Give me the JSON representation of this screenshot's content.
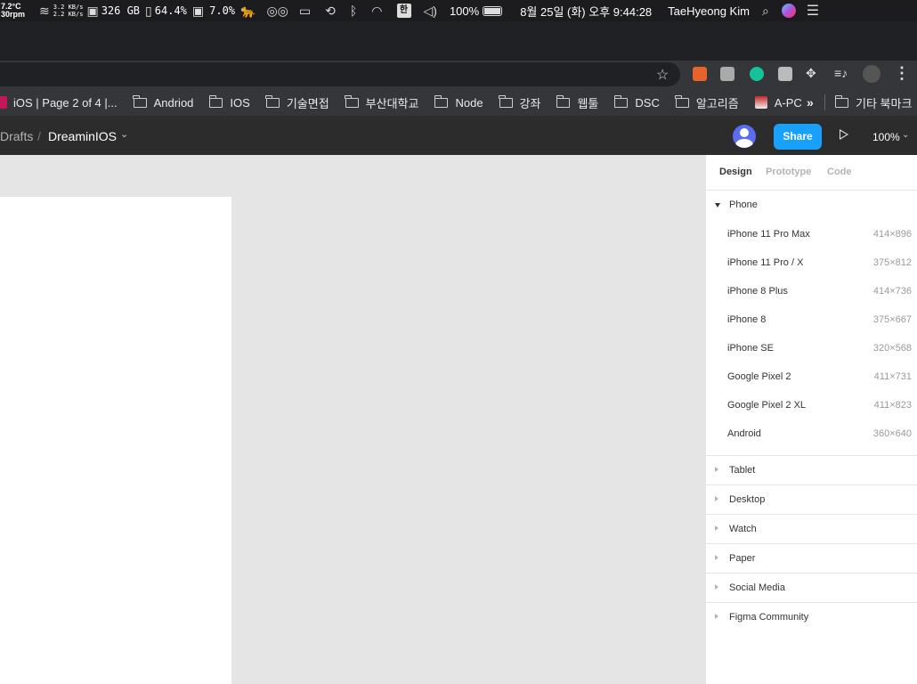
{
  "menubar": {
    "temp_line1": "7.2°C",
    "temp_line2": "30rpm",
    "net_up": "3.2 KB/s",
    "net_down": "2.2 KB/s",
    "disk": "326 GB",
    "memory": "64.4%",
    "cpu": "7.0%",
    "battery_pct": "100%",
    "datetime": "8월 25일 (화) 오후 9:44:28",
    "user": "TaeHyeong Kim",
    "input_lang": "한"
  },
  "bookmarks": [
    {
      "label": "iOS | Page 2 of 4 |...",
      "kind": "site"
    },
    {
      "label": "Andriod",
      "kind": "folder"
    },
    {
      "label": "IOS",
      "kind": "folder"
    },
    {
      "label": "기술면접",
      "kind": "folder"
    },
    {
      "label": "부산대학교",
      "kind": "folder"
    },
    {
      "label": "Node",
      "kind": "folder"
    },
    {
      "label": "강좌",
      "kind": "folder"
    },
    {
      "label": "웹툴",
      "kind": "folder"
    },
    {
      "label": "DSC",
      "kind": "folder"
    },
    {
      "label": "알고리즘",
      "kind": "folder"
    },
    {
      "label": "A-PC",
      "kind": "site"
    }
  ],
  "bookmarks_more": "»",
  "bookmarks_other": "기타 북마크",
  "figma_header": {
    "crumb_drafts": "Drafts",
    "crumb_sep": "/",
    "file_name": "DreaminIOS",
    "share_label": "Share",
    "zoom": "100%"
  },
  "panel": {
    "tabs": [
      "Design",
      "Prototype",
      "Code"
    ],
    "active_tab": "Design",
    "phone_section": "Phone",
    "phone_devices": [
      {
        "name": "iPhone 11 Pro Max",
        "size": "414×896"
      },
      {
        "name": "iPhone 11 Pro / X",
        "size": "375×812"
      },
      {
        "name": "iPhone 8 Plus",
        "size": "414×736"
      },
      {
        "name": "iPhone 8",
        "size": "375×667"
      },
      {
        "name": "iPhone SE",
        "size": "320×568"
      },
      {
        "name": "Google Pixel 2",
        "size": "411×731"
      },
      {
        "name": "Google Pixel 2 XL",
        "size": "411×823"
      },
      {
        "name": "Android",
        "size": "360×640"
      }
    ],
    "collapsed_sections": [
      "Tablet",
      "Desktop",
      "Watch",
      "Paper",
      "Social Media",
      "Figma Community"
    ]
  },
  "colors": {
    "share_button": "#18a0fb",
    "canvas": "#e5e5e5",
    "frame": "#ffffff"
  }
}
